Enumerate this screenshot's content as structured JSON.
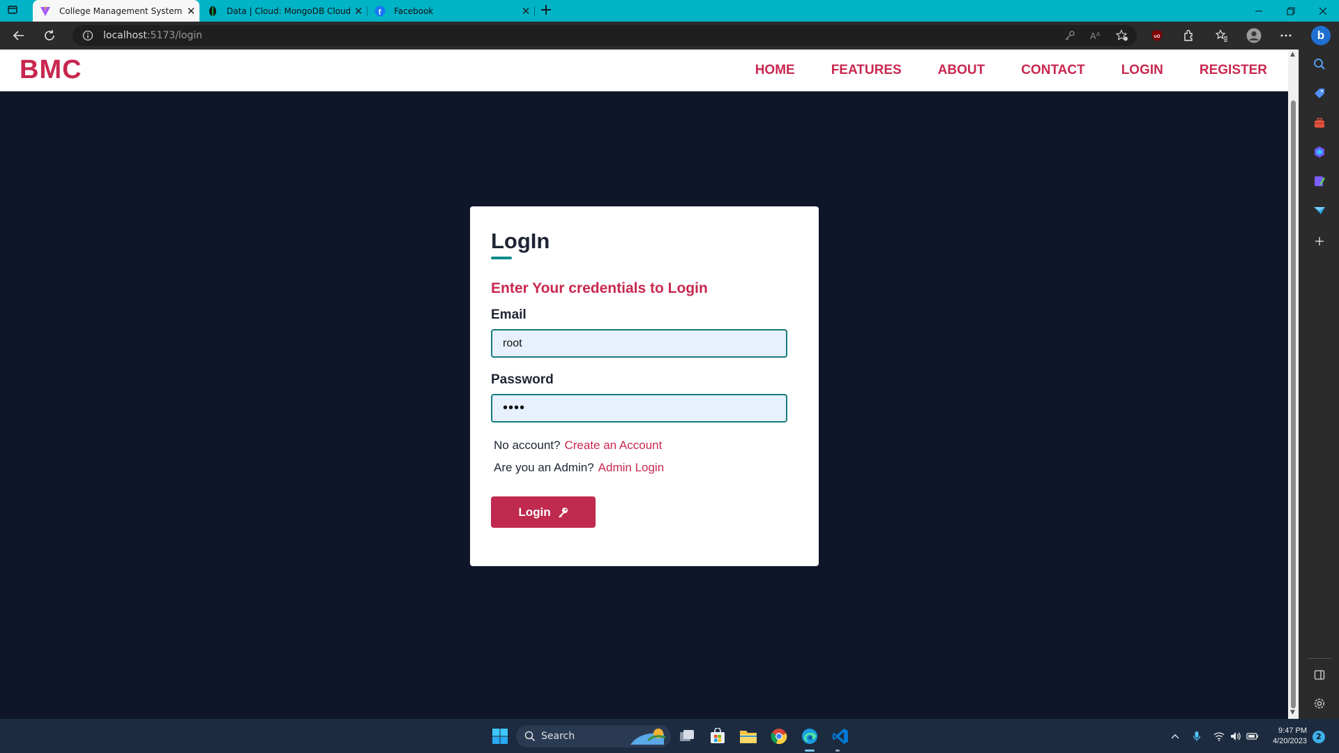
{
  "browser": {
    "tabs": [
      {
        "title": "College Management System",
        "icon": "vite-logo-icon",
        "active": true
      },
      {
        "title": "Data | Cloud: MongoDB Cloud",
        "icon": "mongodb-leaf-icon",
        "active": false
      },
      {
        "title": "Facebook",
        "icon": "facebook-icon",
        "active": false
      }
    ],
    "url_host": "localhost",
    "url_path": ":5173/login"
  },
  "site": {
    "brand": "BMC",
    "nav": [
      "HOME",
      "FEATURES",
      "ABOUT",
      "CONTACT",
      "LOGIN",
      "REGISTER"
    ]
  },
  "login": {
    "title": "LogIn",
    "subtitle": "Enter Your credentials to Login",
    "email_label": "Email",
    "email_value": "root",
    "password_label": "Password",
    "password_value": "••••",
    "no_account_text": "No account?",
    "create_account_link": "Create an Account",
    "admin_text": "Are you an Admin?",
    "admin_login_link": "Admin Login",
    "submit_label": "Login"
  },
  "taskbar": {
    "search_placeholder": "Search",
    "time": "9:47 PM",
    "date": "4/20/2023",
    "notification_count": "2"
  },
  "colors": {
    "accent": "#c8274f",
    "teal": "#137c7c",
    "page_bg": "#0f1629",
    "tab_strip": "#00b3c7"
  }
}
